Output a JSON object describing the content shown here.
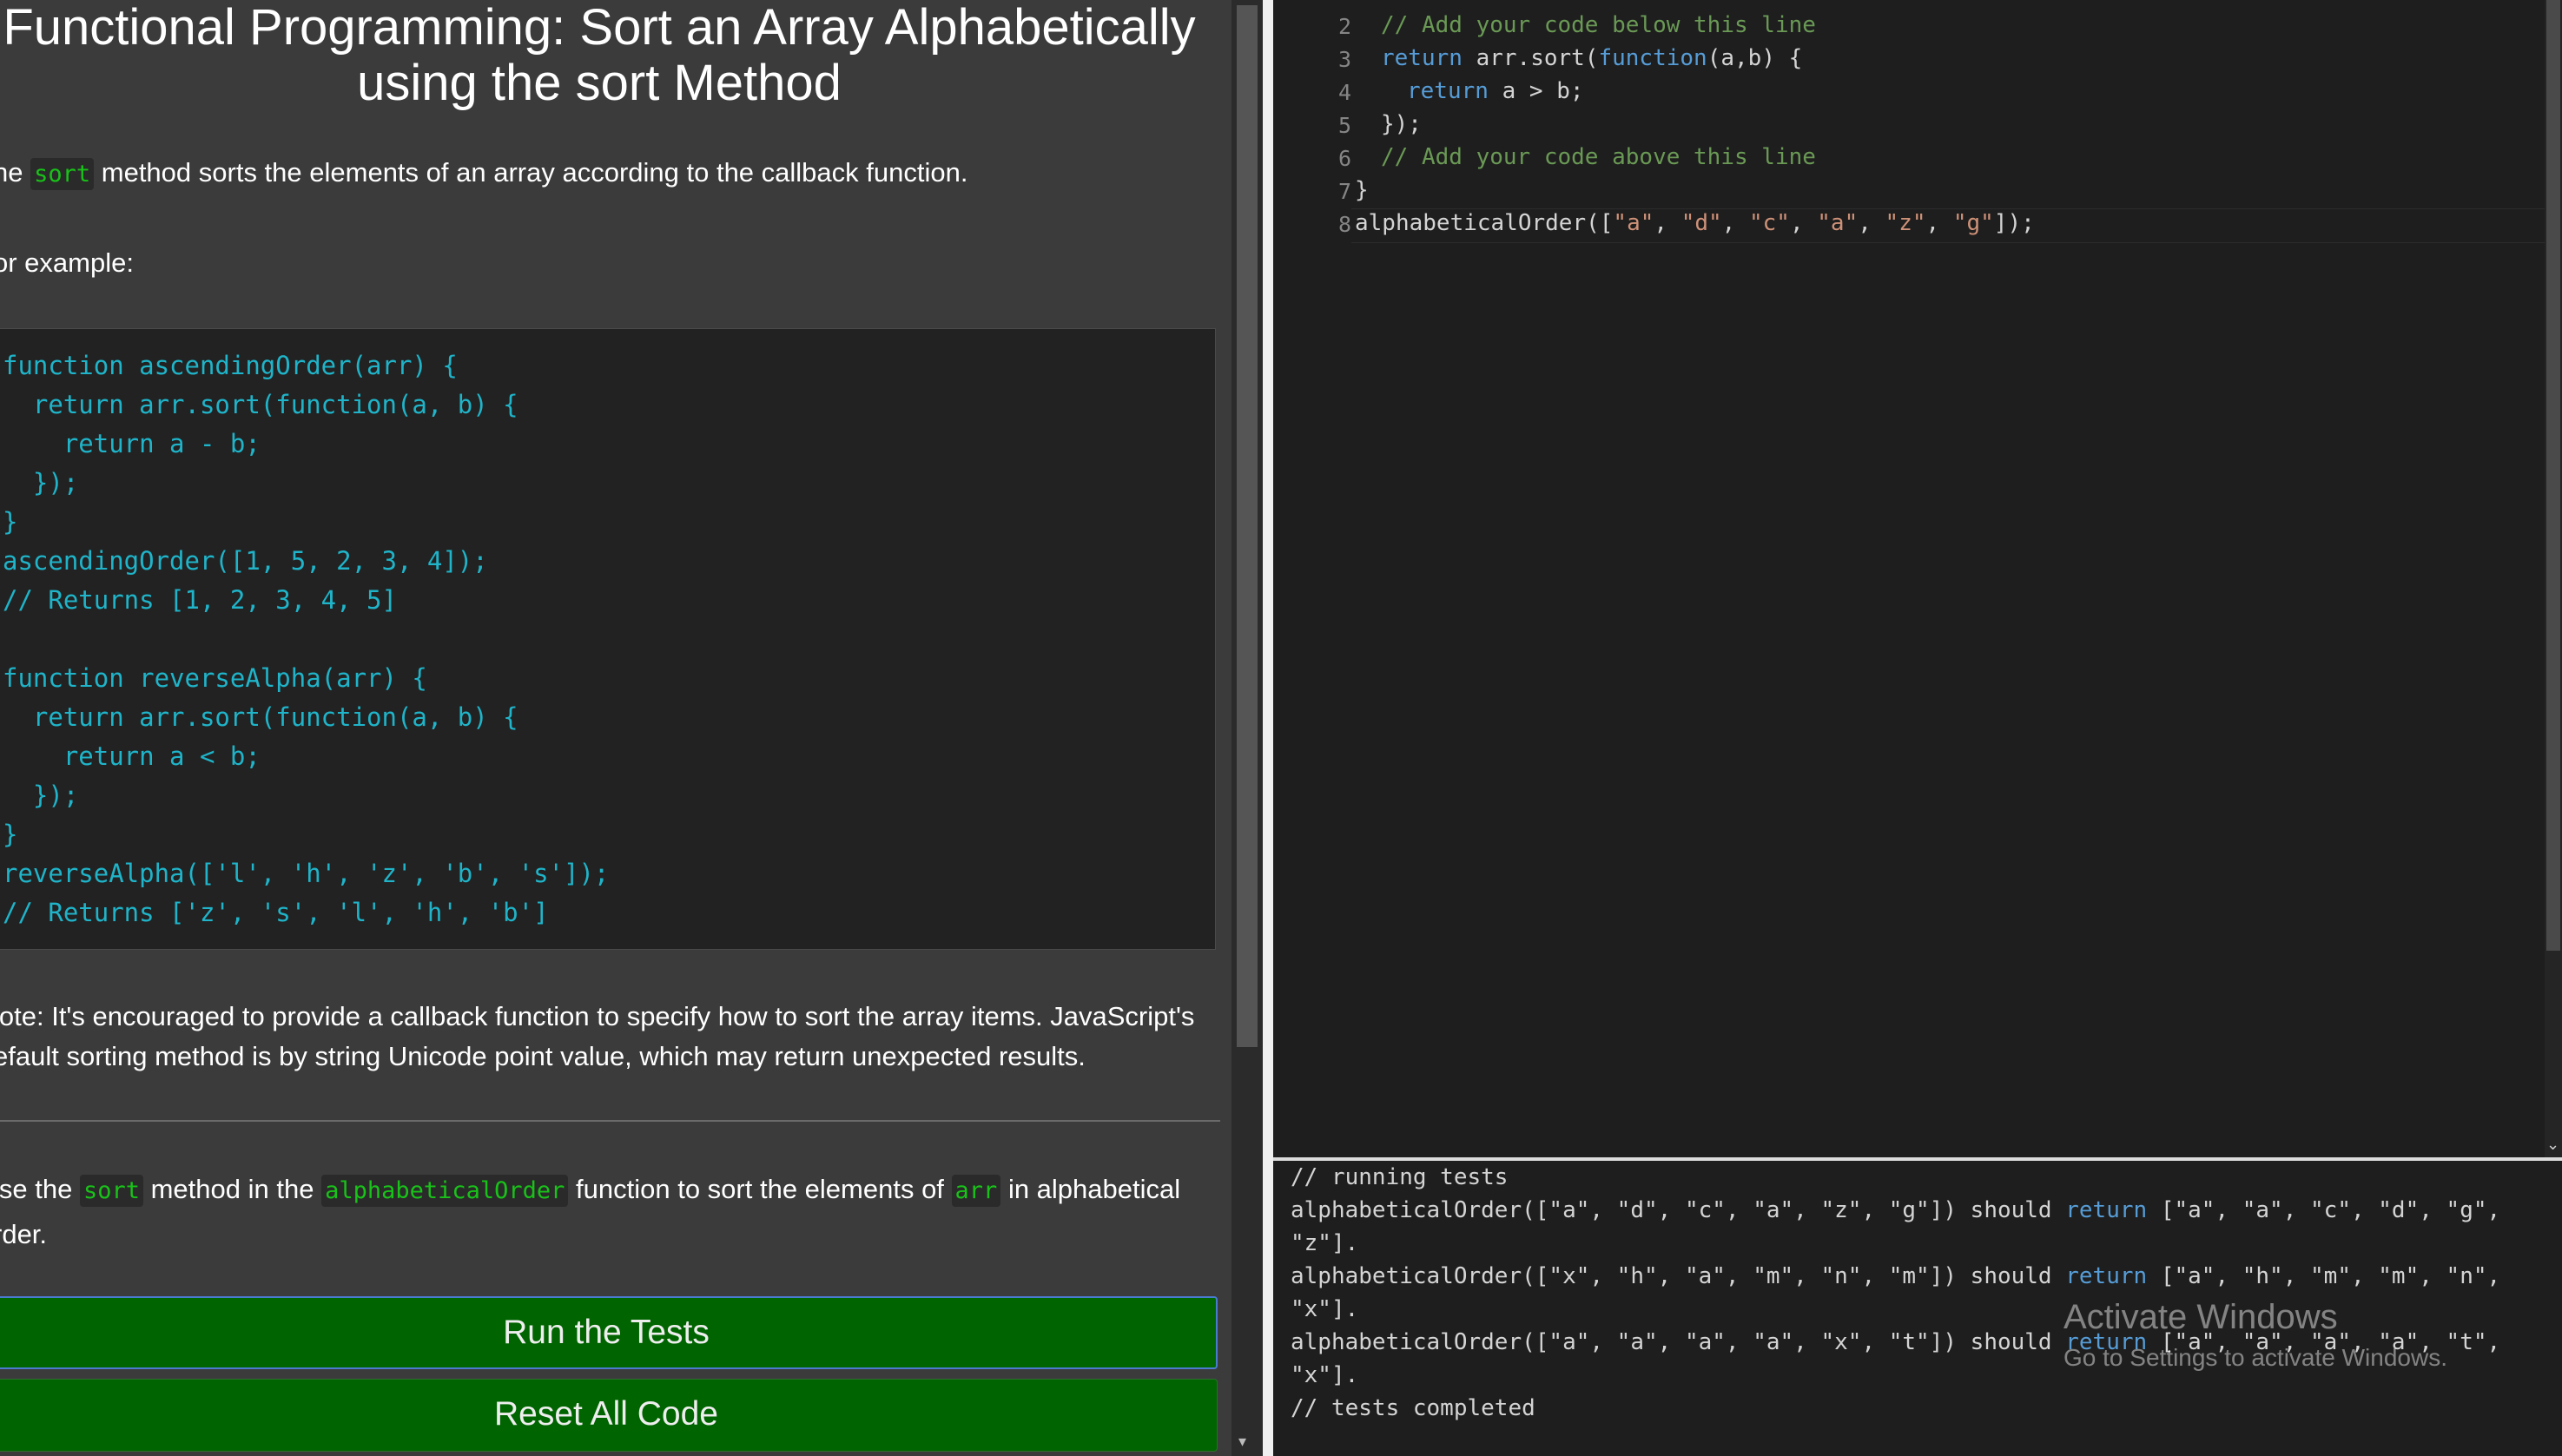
{
  "title_line1": "Functional Programming: Sort an Array Alphabetically",
  "title_line2": "using the sort Method",
  "intro": {
    "a": "he ",
    "code": "sort",
    "b": " method sorts the elements of an array according to the callback function."
  },
  "for_example": "or example:",
  "example_lines": [
    "function ascendingOrder(arr) {",
    "  return arr.sort(function(a, b) {",
    "    return a - b;",
    "  });",
    "}",
    "ascendingOrder([1, 5, 2, 3, 4]);",
    "// Returns [1, 2, 3, 4, 5]",
    "",
    "function reverseAlpha(arr) {",
    "  return arr.sort(function(a, b) {",
    "    return a < b;",
    "  });",
    "}",
    "reverseAlpha(['l', 'h', 'z', 'b', 's']);",
    "// Returns ['z', 's', 'l', 'h', 'b']"
  ],
  "note_line1": "lote: It's encouraged to provide a callback function to specify how to sort the array items. JavaScript's",
  "note_line2": "efault sorting method is by string Unicode point value, which may return unexpected results.",
  "task": {
    "a": "lse the ",
    "c1": "sort",
    "b": " method in the ",
    "c2": "alphabeticalOrder",
    "c": " function to sort the elements of ",
    "c3": "arr",
    "d": " in alphabetical",
    "line2": "rder."
  },
  "buttons": {
    "run": "Run the Tests",
    "reset": "Reset All Code"
  },
  "editor": {
    "line_numbers": [
      "2",
      "3",
      "4",
      "5",
      "6",
      "7",
      "8"
    ],
    "line2_comment": "// Add your code below this line",
    "line3_kw1": "return",
    "line3_mid": " arr.sort(",
    "line3_kw2": "function",
    "line3_end": "(a,b) {",
    "line4_kw": "return",
    "line4_end": " a > b;",
    "line5": "});",
    "line6_comment": "// Add your code above this line",
    "line7": "}",
    "line8_a": "alphabeticalOrder([",
    "line8_args": [
      "\"a\"",
      "\"d\"",
      "\"c\"",
      "\"a\"",
      "\"z\"",
      "\"g\""
    ],
    "line8_end": "]);"
  },
  "output": {
    "running": "// running tests",
    "t1a": "alphabeticalOrder([\"a\", \"d\", \"c\", \"a\", \"z\", \"g\"]) should ",
    "t1b": "return",
    "t1c": " [\"a\", \"a\", \"c\", \"d\", \"g\",",
    "t1d": "\"z\"].",
    "t2a": "alphabeticalOrder([\"x\", \"h\", \"a\", \"m\", \"n\", \"m\"]) should ",
    "t2b": "return",
    "t2c": " [\"a\", \"h\", \"m\", \"m\", \"n\",",
    "t2d": "\"x\"].",
    "t3a": "alphabeticalOrder([\"a\", \"a\", \"a\", \"a\", \"x\", \"t\"]) should ",
    "t3b": "return",
    "t3c": " [\"a\", \"a\", \"a\", \"a\", \"t\",",
    "t3d": "\"x\"].",
    "completed": "// tests completed"
  },
  "watermark": {
    "line1": "Activate Windows",
    "line2": "Go to Settings to activate Windows."
  }
}
